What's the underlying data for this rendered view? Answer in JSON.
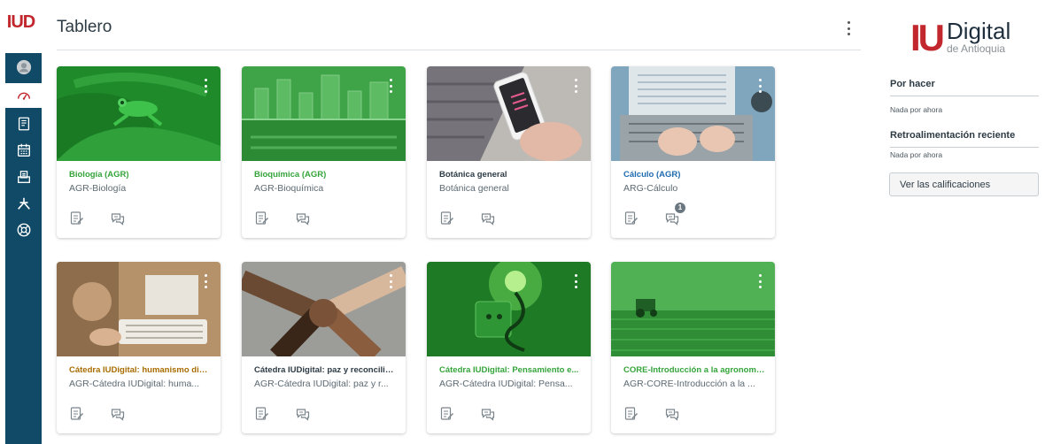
{
  "nav": {
    "logo": "IUD",
    "items": [
      {
        "icon": "account-icon",
        "label": "Cuenta"
      },
      {
        "icon": "dashboard-icon",
        "label": "Tablero"
      },
      {
        "icon": "courses-icon",
        "label": "Cursos"
      },
      {
        "icon": "calendar-icon",
        "label": "Calendario"
      },
      {
        "icon": "inbox-icon",
        "label": "Bandeja de entrada"
      },
      {
        "icon": "commons-icon",
        "label": "Commons"
      },
      {
        "icon": "help-icon",
        "label": "Ayuda"
      }
    ]
  },
  "header": {
    "title": "Tablero"
  },
  "cards": [
    {
      "title": "Biología (AGR)",
      "subtitle": "AGR-Biología",
      "title_color": "#35a43b",
      "image": "frog",
      "discussion_badge": ""
    },
    {
      "title": "Bioquímica (AGR)",
      "subtitle": "AGR-Bioquímica",
      "title_color": "#35a43b",
      "image": "city",
      "discussion_badge": ""
    },
    {
      "title": "Botánica general",
      "subtitle": "Botánica general",
      "title_color": "#2d3b45",
      "image": "phone",
      "discussion_badge": ""
    },
    {
      "title": "Cálculo (AGR)",
      "subtitle": "ARG-Cálculo",
      "title_color": "#1f6bb0",
      "image": "laptop",
      "discussion_badge": "1"
    },
    {
      "title": "Cátedra IUDigital: humanismo digi...",
      "subtitle": "AGR-Cátedra IUDigital: huma...",
      "title_color": "#a86c00",
      "image": "keyboard",
      "discussion_badge": ""
    },
    {
      "title": "Cátedra IUDigital: paz y reconcilia...",
      "subtitle": "AGR-Cátedra IUDigital: paz y r...",
      "title_color": "#2d3b45",
      "image": "hands",
      "discussion_badge": ""
    },
    {
      "title": "Cátedra IUDigital: Pensamiento e...",
      "subtitle": "AGR-Cátedra IUDigital: Pensa...",
      "title_color": "#35a43b",
      "image": "plug",
      "discussion_badge": ""
    },
    {
      "title": "CORE-Introducción a la agronomí...",
      "subtitle": "AGR-CORE-Introducción a la ...",
      "title_color": "#35a43b",
      "image": "tractor",
      "discussion_badge": ""
    }
  ],
  "sidebar": {
    "brand": {
      "iu": "IU",
      "digital": "Digital",
      "sub": "de Antioquia"
    },
    "todo_title": "Por hacer",
    "todo_empty": "Nada por ahora",
    "feedback_title": "Retroalimentación reciente",
    "feedback_empty": "Nada por ahora",
    "grades_button": "Ver las calificaciones"
  },
  "colors": {
    "brand_red": "#c1272d",
    "nav_blue": "#114a67",
    "green": "#35a43b"
  }
}
